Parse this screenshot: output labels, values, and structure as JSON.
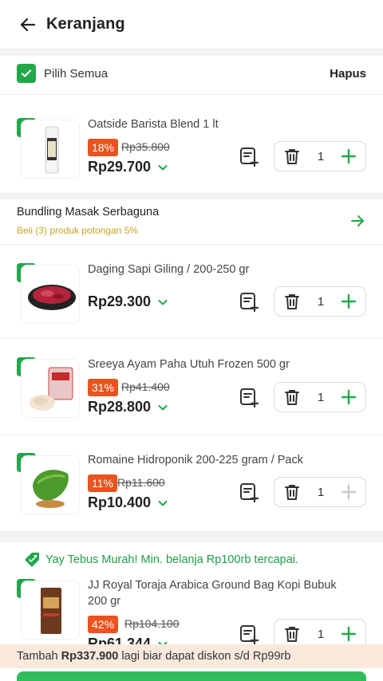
{
  "header": {
    "title": "Keranjang",
    "back_icon": "arrow-left-icon"
  },
  "select_all": {
    "label": "Pilih Semua",
    "delete_label": "Hapus"
  },
  "bundle": {
    "title": "Bundling Masak Serbaguna",
    "subtitle": "Beli (3) produk  potongan 5%"
  },
  "promo": {
    "text": "Yay Tebus Murah! Min. belanja Rp100rb tercapai."
  },
  "items": [
    {
      "name": "Oatside Barista Blend 1 lt",
      "discount": "18%",
      "old_price": "Rp35.800",
      "price": "Rp29.700",
      "qty": "1"
    },
    {
      "name": "Daging Sapi Giling / 200-250 gr",
      "discount": "",
      "old_price": "",
      "price": "Rp29.300",
      "qty": "1"
    },
    {
      "name": "Sreeya Ayam Paha Utuh Frozen 500 gr",
      "discount": "31%",
      "old_price": "Rp41.400",
      "price": "Rp28.800",
      "qty": "1"
    },
    {
      "name": "Romaine Hidroponik 200-225 gram / Pack",
      "discount": "11%",
      "old_price": "Rp11.600",
      "price": "Rp10.400",
      "qty": "1"
    },
    {
      "name_line1": "JJ Royal Toraja Arabica Ground Bag Kopi Bubuk",
      "name_line2": "200 gr",
      "discount": "42%",
      "old_price": "Rp104.100",
      "price": "Rp61.344",
      "qty": "1"
    }
  ],
  "banner": {
    "prefix": "Tambah",
    "amount": "Rp337.900",
    "suffix": "lagi biar dapat diskon s/d Rp99rb"
  },
  "colors": {
    "accent": "#21a84a",
    "discount": "#e8531e",
    "bundle_sub": "#c9a227",
    "banner_bg": "#fbe9de"
  }
}
